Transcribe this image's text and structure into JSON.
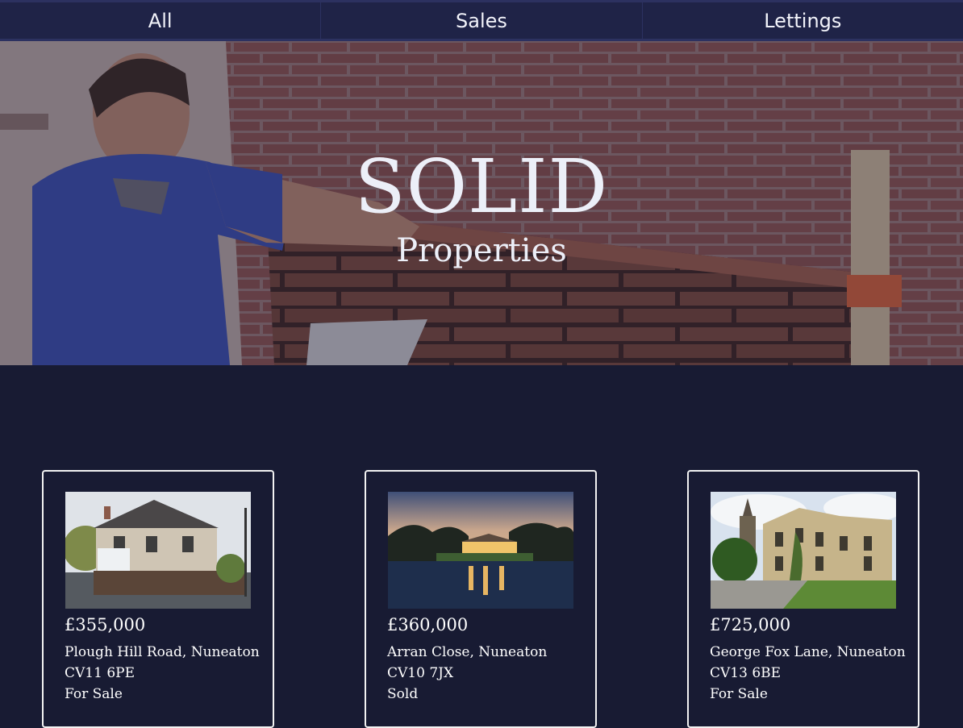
{
  "nav": {
    "tabs": [
      {
        "label": "All"
      },
      {
        "label": "Sales"
      },
      {
        "label": "Lettings"
      }
    ]
  },
  "hero": {
    "title": "SOLID",
    "subtitle": "Properties"
  },
  "listings": [
    {
      "price": "£355,000",
      "address": "Plough Hill Road, Nuneaton",
      "postcode": "CV11 6PE",
      "status": "For Sale",
      "photo_icon": "house-photo-icon"
    },
    {
      "price": "£360,000",
      "address": "Arran Close, Nuneaton",
      "postcode": "CV10 7JX",
      "status": "Sold",
      "photo_icon": "lake-house-photo-icon"
    },
    {
      "price": "£725,000",
      "address": "George Fox Lane, Nuneaton",
      "postcode": "CV13 6BE",
      "status": "For Sale",
      "photo_icon": "mansion-photo-icon"
    }
  ],
  "colors": {
    "background": "#181b33",
    "nav": "#1f2347",
    "text": "#ffffff"
  }
}
